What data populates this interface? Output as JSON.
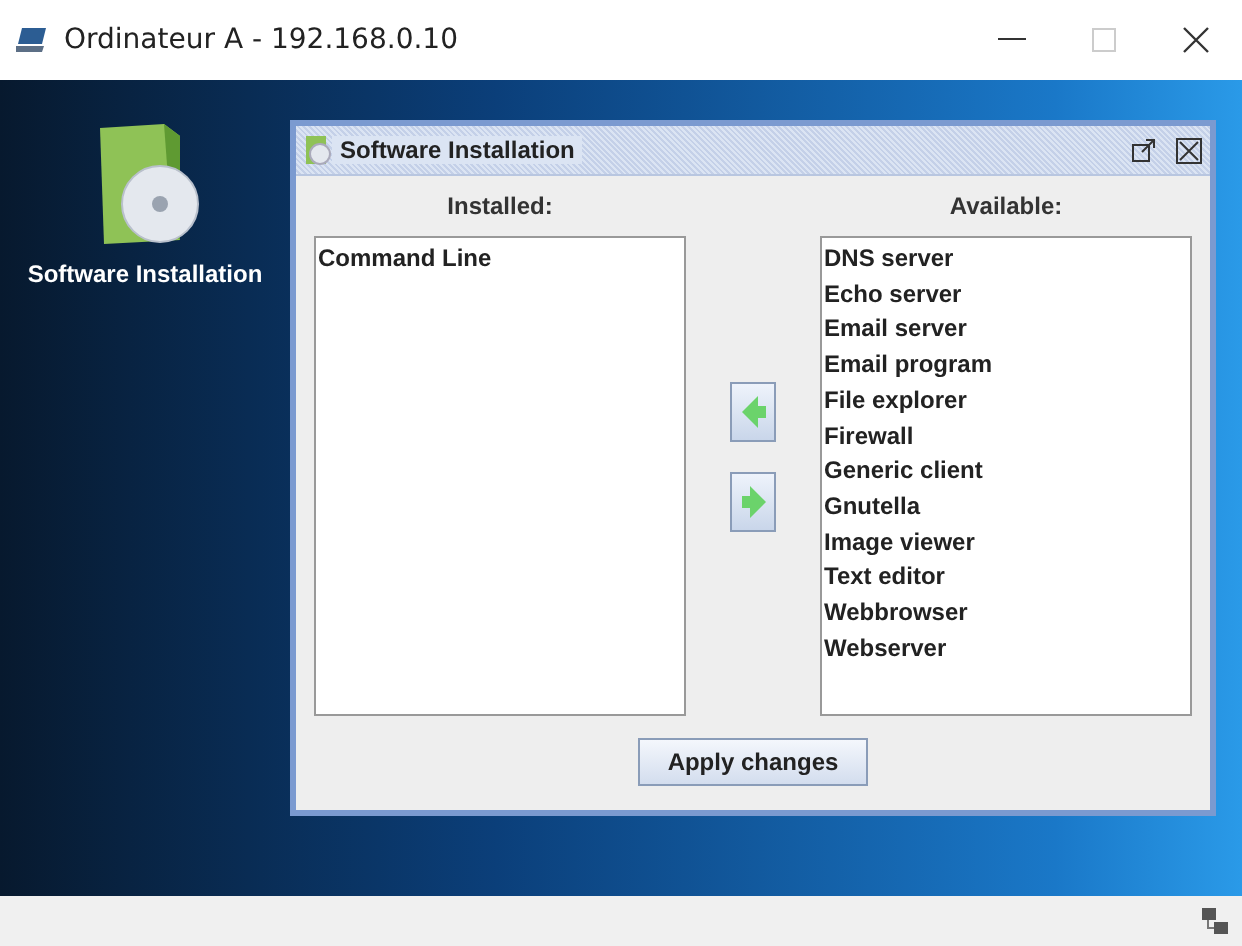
{
  "window": {
    "title": "Ordinateur A - 192.168.0.10"
  },
  "desktop_icons": [
    {
      "label": "Software Installation"
    }
  ],
  "dialog": {
    "title": "Software Installation",
    "installed": {
      "label": "Installed:",
      "items": [
        "Command Line"
      ]
    },
    "available": {
      "label": "Available:",
      "items": [
        "DNS server",
        "Echo server",
        "Email server",
        "Email program",
        "File explorer",
        "Firewall",
        "Generic client",
        "Gnutella",
        "Image viewer",
        "Text editor",
        "Webbrowser",
        "Webserver"
      ]
    },
    "apply_button": "Apply changes"
  }
}
